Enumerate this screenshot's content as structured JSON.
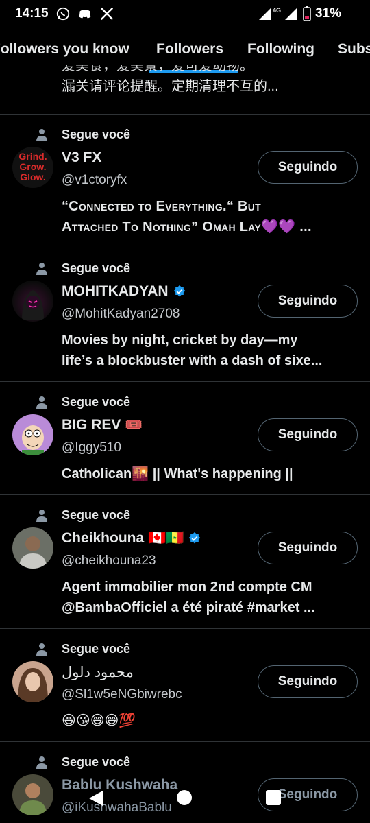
{
  "status_bar": {
    "time": "14:15",
    "battery": "31%",
    "network": "4G",
    "icons": [
      "whatsapp-icon",
      "discord-icon",
      "x-icon",
      "signal-icon",
      "battery-icon"
    ]
  },
  "tabs": [
    {
      "label": "Followers you know"
    },
    {
      "label": "Followers"
    },
    {
      "label": "Following"
    },
    {
      "label": "Subs"
    }
  ],
  "top_bio": {
    "line1": "爱美食，爱美景，爱可爱动物。",
    "line2": "漏关请评论提醒。定期清理不互的..."
  },
  "follows_you_label": "Segue você",
  "button_label": "Seguindo",
  "users": [
    {
      "name": "V3 FX",
      "handle": "@v1ctoryfx",
      "verified": false,
      "bio1": "“Connected to Everything.“ But",
      "bio2": "Attached To Nothing” Omah Lay💜💜 ...",
      "avatar_text": "Grind. Grow. Glow."
    },
    {
      "name": "MOHITKADYAN",
      "handle": "@MohitKadyan2708",
      "verified": true,
      "bio1": "Movies by night, cricket by day—my",
      "bio2": "life’s a blockbuster with a dash of sixe..."
    },
    {
      "name": "BIG REV 🎟️",
      "handle": "@Iggy510",
      "verified": false,
      "bio1": "Catholican🌇 || What's happening  ||",
      "bio2": ""
    },
    {
      "name": "Cheikhouna 🇨🇦🇸🇳",
      "handle": "@cheikhouna23",
      "verified": true,
      "bio1": "Agent immobilier mon 2nd compte CM",
      "bio2": "@BambaOfficiel a été piraté #market ..."
    },
    {
      "name": "محمود دلول",
      "handle": "@Sl1w5eNGbiwrebc",
      "verified": false,
      "bio1": "😆😘😄😄💯",
      "bio2": ""
    },
    {
      "name": "Bablu Kushwaha",
      "handle": "@iKushwahaBablu",
      "verified": false,
      "bio1": "",
      "bio2": ""
    }
  ],
  "colors": {
    "background": "#000000",
    "text": "#e7e9ea",
    "accent": "#1d9bf0",
    "divider": "#2f3336"
  }
}
